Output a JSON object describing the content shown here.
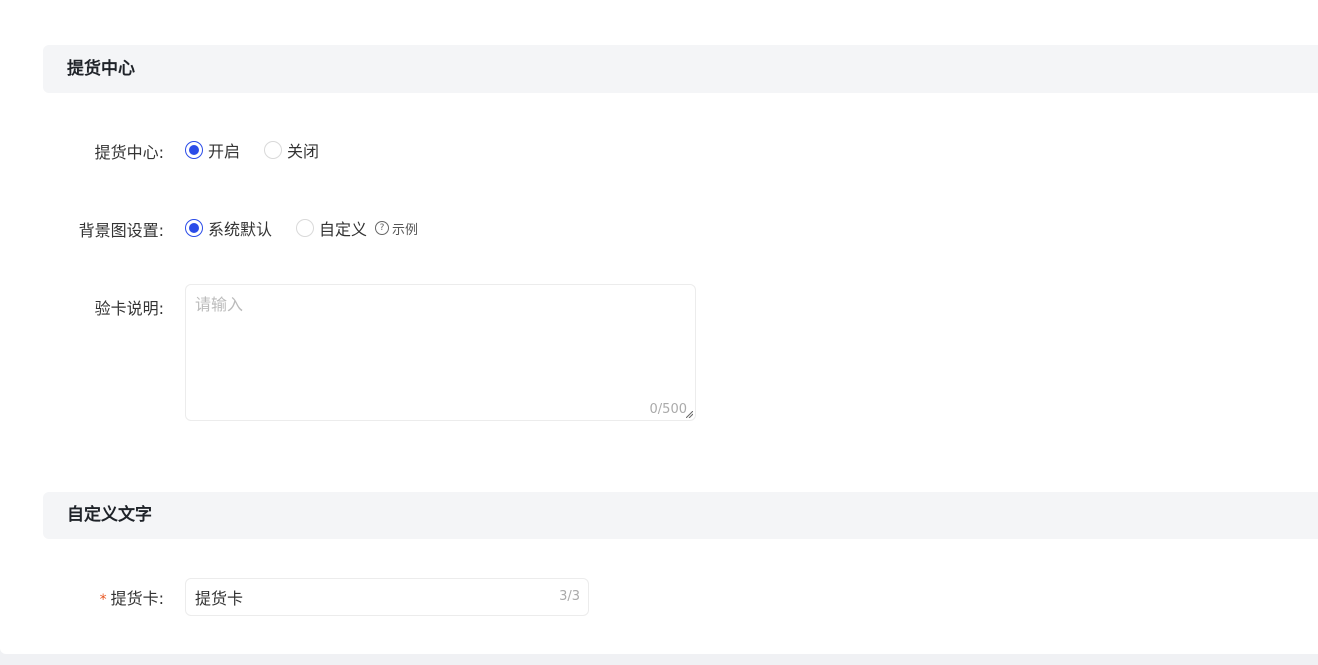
{
  "sections": {
    "pickup_center": {
      "title": "提货中心"
    },
    "custom_text": {
      "title": "自定义文字"
    }
  },
  "pickup_center_toggle": {
    "label": "提货中心:",
    "options": [
      {
        "label": "开启",
        "checked": true
      },
      {
        "label": "关闭",
        "checked": false
      }
    ]
  },
  "background_setting": {
    "label": "背景图设置:",
    "options": [
      {
        "label": "系统默认",
        "checked": true
      },
      {
        "label": "自定义",
        "checked": false
      }
    ],
    "example_link": "示例",
    "example_icon": "question-circle-icon"
  },
  "card_description": {
    "label": "验卡说明:",
    "placeholder": "请输入",
    "value": "",
    "counter": "0/500"
  },
  "pickup_card": {
    "required": "*",
    "label": "提货卡:",
    "value": "提货卡",
    "counter": "3/3"
  },
  "colors": {
    "accent": "#2b4ce8",
    "required": "#e8541f",
    "section_bg": "#f4f5f7"
  }
}
